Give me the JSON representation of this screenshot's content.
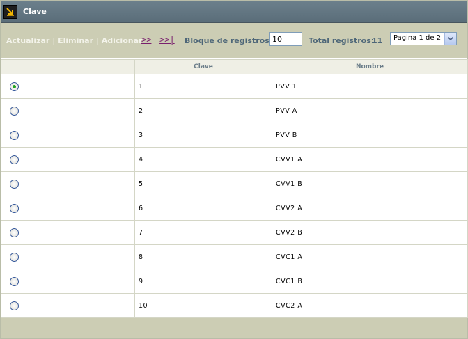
{
  "window": {
    "title": "Clave"
  },
  "toolbar": {
    "actions": [
      "Actualizar",
      "Eliminar",
      "Adicionar"
    ],
    "next_label": ">>",
    "last_label": ">>|",
    "block_label": "Bloque de registros:",
    "block_value": "10",
    "total_label": "Total registros:",
    "total_value": "11",
    "page_select": "Pagina 1 de 2"
  },
  "table": {
    "columns": [
      "",
      "Clave",
      "Nombre"
    ],
    "rows": [
      {
        "clave": "1",
        "nombre": "PVV 1",
        "selected": true
      },
      {
        "clave": "2",
        "nombre": "PVV A",
        "selected": false
      },
      {
        "clave": "3",
        "nombre": "PVV B",
        "selected": false
      },
      {
        "clave": "4",
        "nombre": "CVV1 A",
        "selected": false
      },
      {
        "clave": "5",
        "nombre": "CVV1 B",
        "selected": false
      },
      {
        "clave": "6",
        "nombre": "CVV2 A",
        "selected": false
      },
      {
        "clave": "7",
        "nombre": "CVV2 B",
        "selected": false
      },
      {
        "clave": "8",
        "nombre": "CVC1 A",
        "selected": false
      },
      {
        "clave": "9",
        "nombre": "CVC1 B",
        "selected": false
      },
      {
        "clave": "10",
        "nombre": "CVC2 A",
        "selected": false
      }
    ]
  }
}
